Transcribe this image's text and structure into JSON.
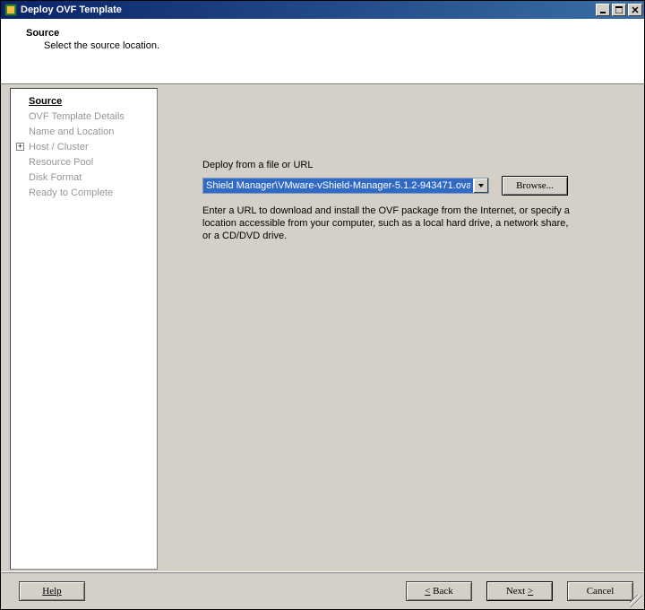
{
  "window": {
    "title": "Deploy OVF Template"
  },
  "header": {
    "title": "Source",
    "description": "Select the source location."
  },
  "sidebar": {
    "items": [
      {
        "label": "Source",
        "active": true
      },
      {
        "label": "OVF Template Details"
      },
      {
        "label": "Name and Location"
      },
      {
        "label": "Host / Cluster",
        "expandable": true
      },
      {
        "label": "Resource Pool"
      },
      {
        "label": "Disk Format"
      },
      {
        "label": "Ready to Complete"
      }
    ]
  },
  "main": {
    "field_label": "Deploy from a file or URL",
    "path_value": "Shield Manager\\VMware-vShield-Manager-5.1.2-943471.ova",
    "browse_label": "Browse...",
    "help_text": "Enter a URL to download and install the OVF package from the Internet, or specify a location accessible from your computer, such as a local hard drive, a network share, or a CD/DVD drive."
  },
  "footer": {
    "help": "Help",
    "back_prefix": "<",
    "back_label": " Back",
    "next_label": "Next ",
    "next_suffix": ">",
    "cancel": "Cancel"
  }
}
